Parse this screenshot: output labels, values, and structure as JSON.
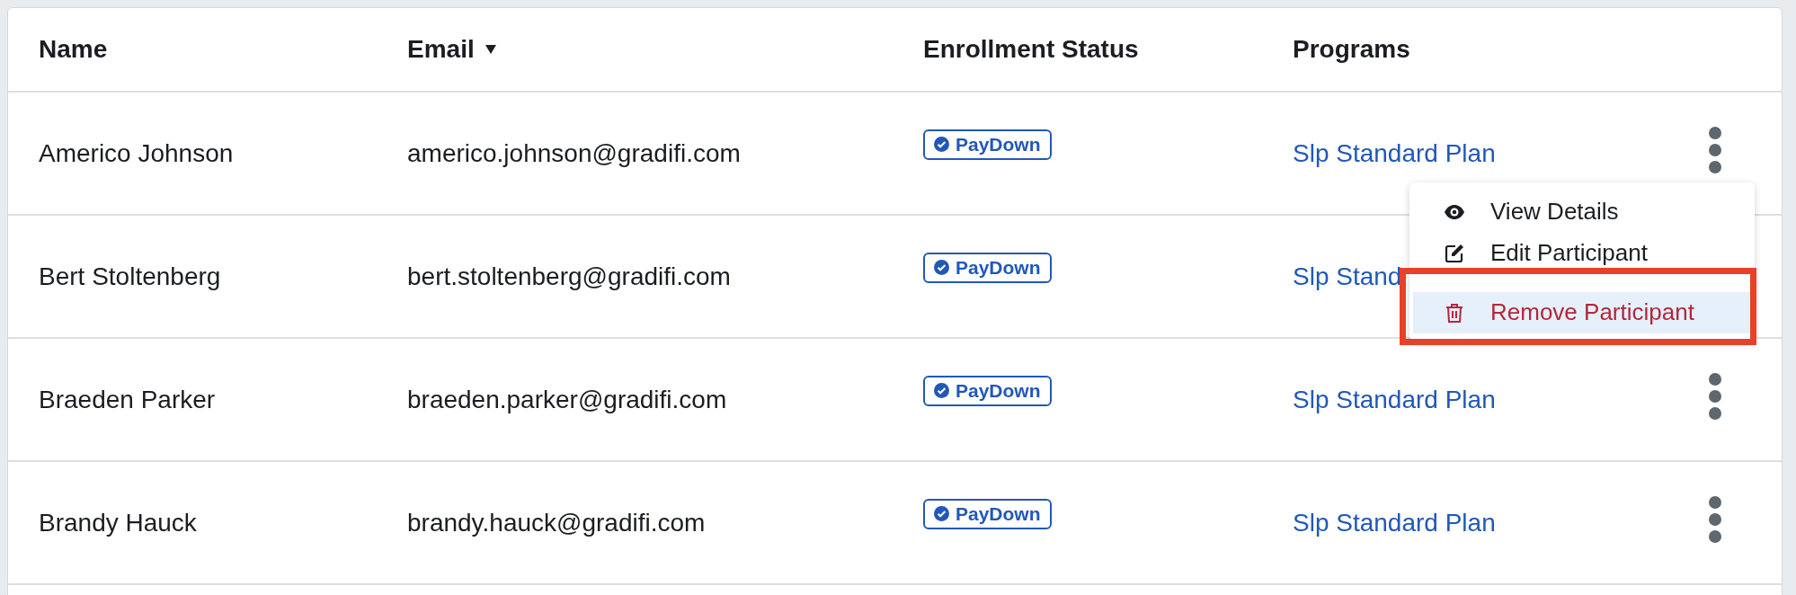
{
  "table": {
    "columns": [
      {
        "label": "Name",
        "sorted": false
      },
      {
        "label": "Email",
        "sorted": true
      },
      {
        "label": "Enrollment Status",
        "sorted": false
      },
      {
        "label": "Programs",
        "sorted": false
      }
    ],
    "rows": [
      {
        "name": "Americo Johnson",
        "email": "americo.johnson@gradifi.com",
        "status": "PayDown",
        "program": "Slp Standard Plan"
      },
      {
        "name": "Bert Stoltenberg",
        "email": "bert.stoltenberg@gradifi.com",
        "status": "PayDown",
        "program": "Slp Stand"
      },
      {
        "name": "Braeden Parker",
        "email": "braeden.parker@gradifi.com",
        "status": "PayDown",
        "program": "Slp Standard Plan"
      },
      {
        "name": "Brandy Hauck",
        "email": "brandy.hauck@gradifi.com",
        "status": "PayDown",
        "program": "Slp Standard Plan"
      }
    ]
  },
  "row_menu": {
    "open": true,
    "items": [
      {
        "kind": "view",
        "label": "View Details",
        "selected": false
      },
      {
        "kind": "edit",
        "label": "Edit Participant",
        "selected": false
      },
      {
        "kind": "remove",
        "label": "Remove Participant",
        "selected": true
      }
    ],
    "highlighted": true
  }
}
